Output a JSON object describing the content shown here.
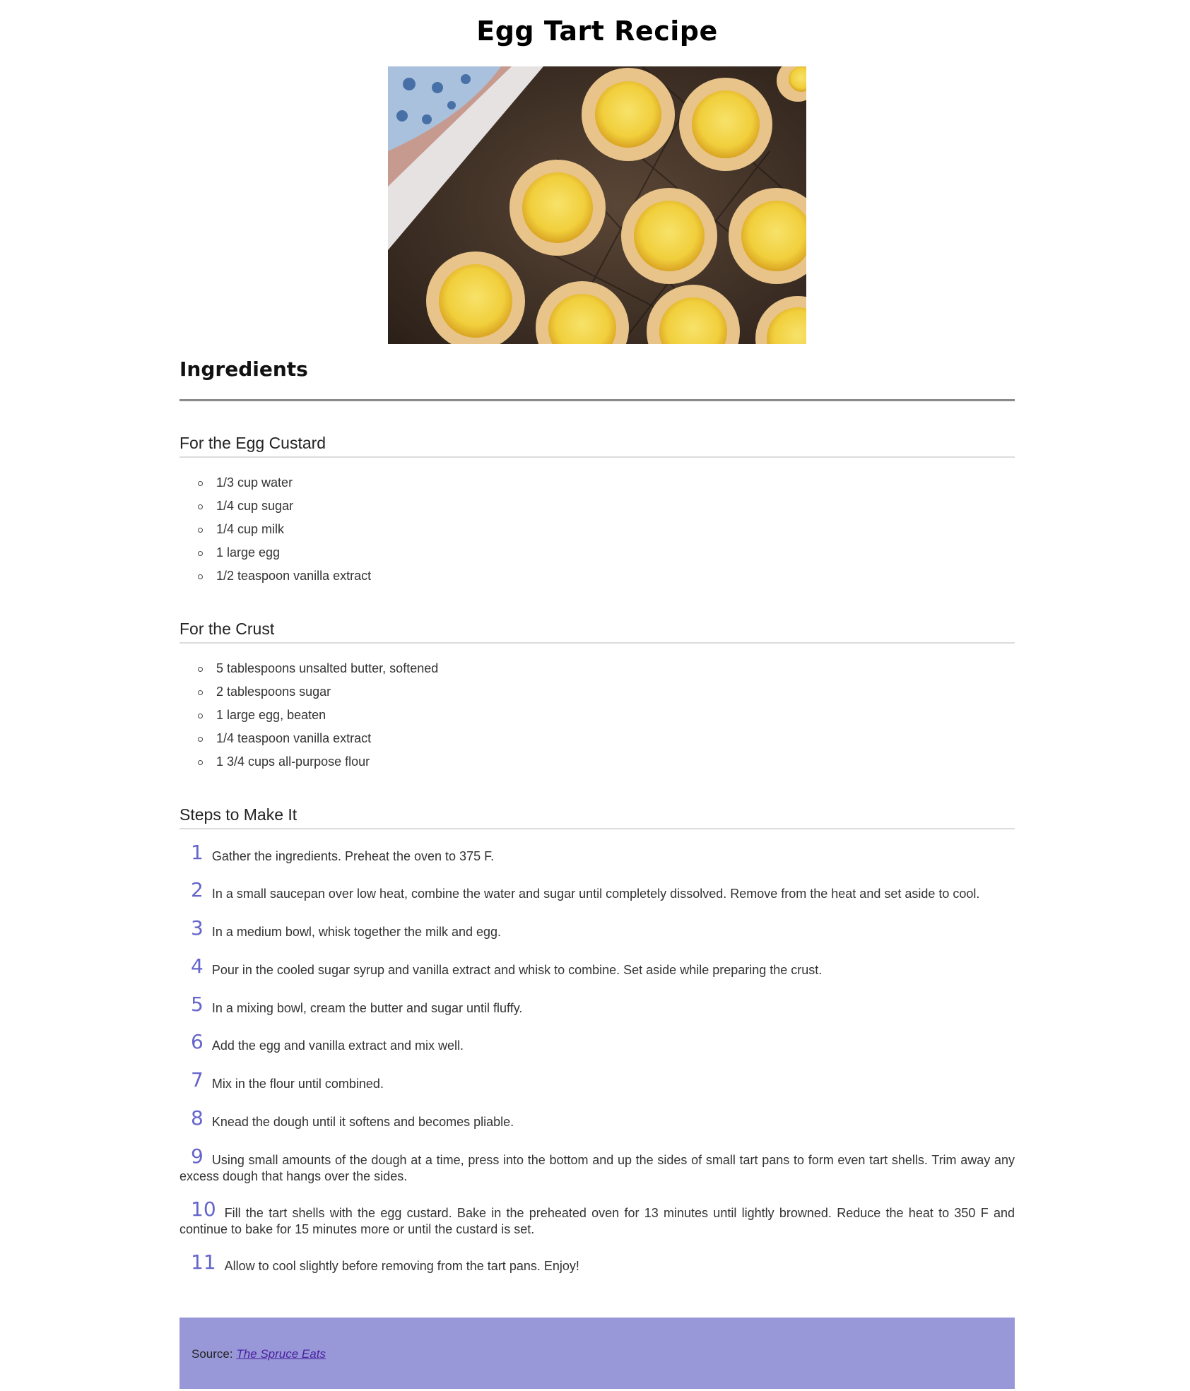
{
  "title": "Egg Tart Recipe",
  "hero_image": {
    "alt": "Egg tarts on a tart pan"
  },
  "ingredients_heading": "Ingredients",
  "sections": {
    "custard": {
      "heading": "For the Egg Custard",
      "items": [
        "1/3 cup water",
        "1/4 cup sugar",
        "1/4 cup milk",
        "1 large egg",
        "1/2 teaspoon vanilla extract"
      ]
    },
    "crust": {
      "heading": "For the Crust",
      "items": [
        "5 tablespoons unsalted butter, softened",
        "2 tablespoons sugar",
        "1 large egg, beaten",
        "1/4 teaspoon vanilla extract",
        "1 3/4 cups all-purpose flour"
      ]
    }
  },
  "steps_heading": "Steps to Make It",
  "steps": [
    {
      "n": "1",
      "text": "Gather the ingredients. Preheat the oven to 375 F."
    },
    {
      "n": "2",
      "text": "In a small saucepan over low heat, combine the water and sugar until completely dissolved. Remove from the heat and set aside to cool."
    },
    {
      "n": "3",
      "text": "In a medium bowl, whisk together the milk and egg."
    },
    {
      "n": "4",
      "text": "Pour in the cooled sugar syrup and vanilla extract and whisk to combine. Set aside while preparing the crust."
    },
    {
      "n": "5",
      "text": "In a mixing bowl, cream the butter and sugar until fluffy."
    },
    {
      "n": "6",
      "text": "Add the egg and vanilla extract and mix well."
    },
    {
      "n": "7",
      "text": "Mix in the flour until combined."
    },
    {
      "n": "8",
      "text": "Knead the dough until it softens and becomes pliable."
    },
    {
      "n": "9",
      "text": "Using small amounts of the dough at a time, press into the bottom and up the sides of small tart pans to form even tart shells. Trim away any excess dough that hangs over the sides."
    },
    {
      "n": "10",
      "text": "Fill the tart shells with the egg custard. Bake in the preheated oven for 13 minutes until lightly browned. Reduce the heat to 350 F and continue to bake for 15 minutes more or until the custard is set."
    },
    {
      "n": "11",
      "text": "Allow to cool slightly before removing from the tart pans. Enjoy!"
    }
  ],
  "footer": {
    "source_label": "Source: ",
    "source_link": "The Spruce Eats"
  },
  "colors": {
    "step_number": "#6565cc",
    "footer_bg": "#9898d8",
    "link": "#4a1fa0"
  }
}
